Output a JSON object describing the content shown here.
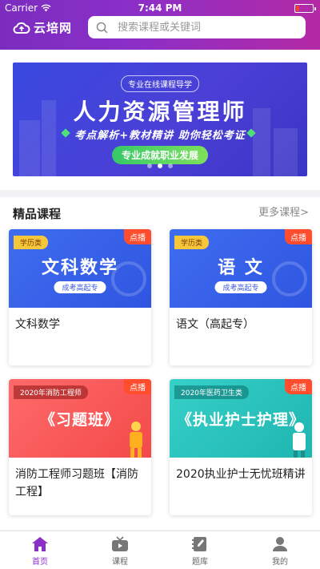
{
  "status_bar": {
    "carrier": "Carrier",
    "time": "7:44 PM"
  },
  "header": {
    "logo_text": "云培网",
    "search_placeholder": "搜索课程或关键词"
  },
  "banner": {
    "tag": "专业在线课程导学",
    "title": "人力资源管理师",
    "subtitle": "考点解析+教材精讲 助你轻松考证",
    "button": "专业成就职业发展",
    "slide_count": 3,
    "active_slide": 2
  },
  "section": {
    "title": "精品课程",
    "more": "更多课程>"
  },
  "courses": [
    {
      "category": "学历类",
      "play": "点播",
      "thumb_title": "文科数学",
      "thumb_sub": "成考高起专",
      "name": "文科数学"
    },
    {
      "category": "学历类",
      "play": "点播",
      "thumb_title": "语 文",
      "thumb_sub": "成考高起专",
      "name": "语文（高起专）"
    },
    {
      "category": "2020年消防工程师",
      "play": "点播",
      "thumb_title": "《习题班》",
      "name": "消防工程师习题班【消防工程】"
    },
    {
      "category": "2020年医药卫生类",
      "play": "点播",
      "thumb_title": "《执业护士护理》",
      "name": "2020执业护士无忧班精讲"
    }
  ],
  "tabbar": {
    "items": [
      {
        "label": "首页"
      },
      {
        "label": "课程"
      },
      {
        "label": "题库"
      },
      {
        "label": "我的"
      }
    ]
  },
  "colors": {
    "brand_purple": "#8a2fc8",
    "play_badge": "#ff4d2e"
  }
}
